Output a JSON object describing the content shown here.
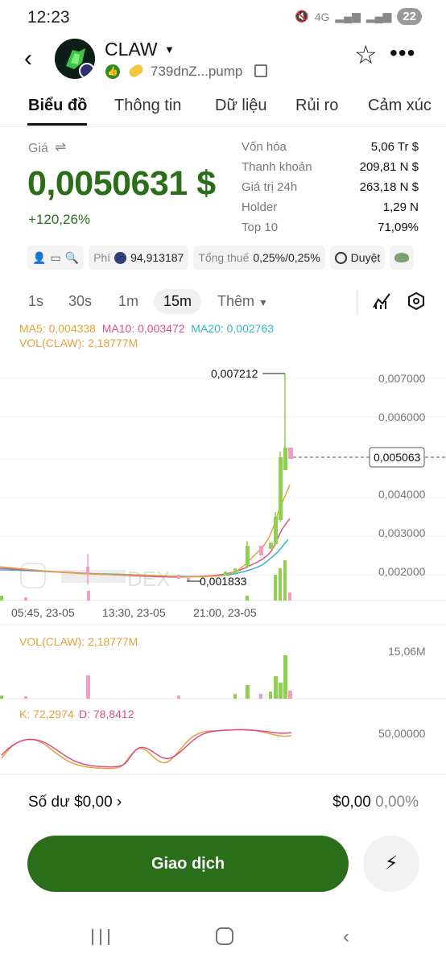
{
  "status": {
    "time": "12:23",
    "network": "4G",
    "battery": "22"
  },
  "header": {
    "token_name": "CLAW",
    "address": "739dnZ...pump"
  },
  "tabs": [
    {
      "label": "Biểu đồ"
    },
    {
      "label": "Thông tin"
    },
    {
      "label": "Dữ liệu"
    },
    {
      "label": "Rủi ro"
    },
    {
      "label": "Cảm xúc"
    }
  ],
  "price": {
    "label": "Giá",
    "value": "0,0050631 $",
    "change": "+120,26%"
  },
  "stats": [
    {
      "label": "Vốn hóa",
      "value": "5,06 Tr $"
    },
    {
      "label": "Thanh khoản",
      "value": "209,81 N $"
    },
    {
      "label": "Giá trị 24h",
      "value": "263,18 N $"
    },
    {
      "label": "Holder",
      "value": "1,29 N"
    },
    {
      "label": "Top 10",
      "value": "71,09%"
    }
  ],
  "chips": {
    "fee_label": "Phí",
    "fee_value": "94,913187",
    "tax_label": "Tổng thuế",
    "tax_value": "0,25%/0,25%",
    "review_label": "Duyệt"
  },
  "intervals": [
    {
      "label": "1s"
    },
    {
      "label": "30s"
    },
    {
      "label": "1m"
    },
    {
      "label": "15m"
    },
    {
      "label": "Thêm"
    }
  ],
  "chart": {
    "ma5": "MA5: 0,004338",
    "ma10": "MA10: 0,003472",
    "ma20": "MA20: 0,002763",
    "vol_top": "VOL(CLAW): 2,18777M",
    "high_label": "0,007212",
    "low_label": "0,001833",
    "current_price": "0,005063",
    "y_ticks": [
      "0,007000",
      "0,006000",
      "0,005000",
      "0,004000",
      "0,003000",
      "0,002000"
    ],
    "x_ticks": [
      "05:45, 23-05",
      "13:30, 23-05",
      "21:00, 23-05"
    ],
    "watermark": "DEX",
    "vol_label": "VOL(CLAW): 2,18777M",
    "vol_max": "15,06M",
    "k_label": "K: 72,2974",
    "d_label": "D: 78,8412",
    "kd_tick": "50,00000"
  },
  "chart_data": {
    "type": "candlestick",
    "y_range": [
      0.0016,
      0.0076
    ],
    "marked_high": 0.007212,
    "marked_low": 0.001833,
    "current": 0.005063
  },
  "bottom": {
    "balance": "Số dư $0,00",
    "balance_usd": "$0,00",
    "balance_pct": "0,00%",
    "trade": "Giao dịch"
  },
  "colors": {
    "up": "#8fd14f",
    "down": "#f29bc3",
    "brand": "#2a6e1a",
    "ma5": "#e6a23c",
    "ma10": "#d94f8a",
    "ma20": "#2fb8cf"
  }
}
